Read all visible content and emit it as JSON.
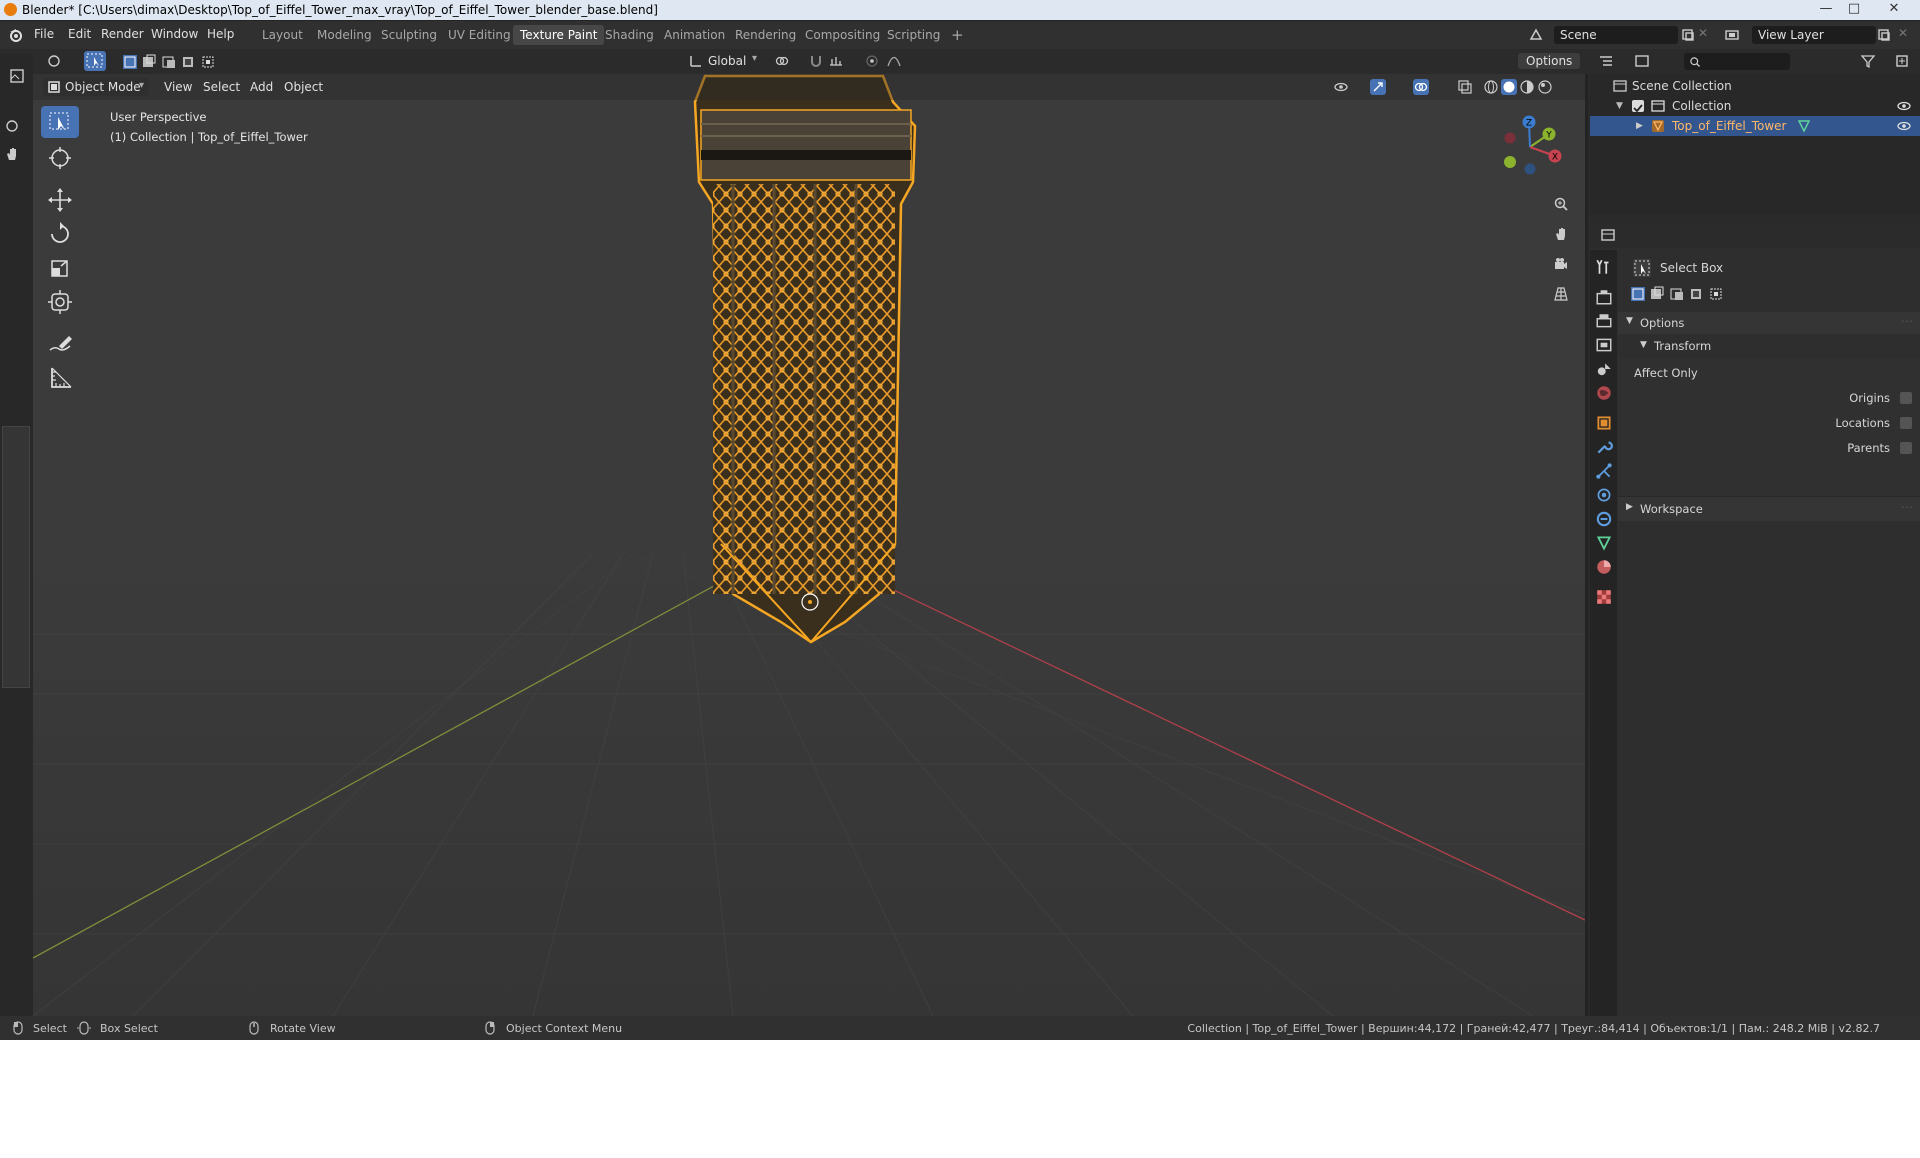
{
  "window": {
    "title": "Blender* [C:\\Users\\dimax\\Desktop\\Top_of_Eiffel_Tower_max_vray\\Top_of_Eiffel_Tower_blender_base.blend]"
  },
  "menus": [
    "File",
    "Edit",
    "Render",
    "Window",
    "Help"
  ],
  "workspaces": [
    "Layout",
    "Modeling",
    "Sculpting",
    "UV Editing",
    "Texture Paint",
    "Shading",
    "Animation",
    "Rendering",
    "Compositing",
    "Scripting"
  ],
  "active_workspace": "Texture Paint",
  "scene": {
    "name": "Scene",
    "view_layer": "View Layer"
  },
  "viewport": {
    "mode": "Object Mode",
    "menus": [
      "View",
      "Select",
      "Add",
      "Object"
    ],
    "orientation": "Global",
    "options_label": "Options",
    "overlay_title": "User Perspective",
    "overlay_subtitle": "(1) Collection | Top_of_Eiffel_Tower",
    "gizmo": {
      "x": "X",
      "y": "Y",
      "z": "Z"
    }
  },
  "outliner": {
    "root": "Scene Collection",
    "collection": "Collection",
    "object": "Top_of_Eiffel_Tower"
  },
  "properties": {
    "tool_name": "Select Box",
    "options_header": "Options",
    "transform_header": "Transform",
    "affect_only": "Affect Only",
    "checks": [
      {
        "label": "Origins",
        "checked": false
      },
      {
        "label": "Locations",
        "checked": false
      },
      {
        "label": "Parents",
        "checked": false
      }
    ],
    "workspace_header": "Workspace"
  },
  "status": {
    "select": "Select",
    "box_select": "Box Select",
    "rotate_view": "Rotate View",
    "context_menu": "Object Context Menu",
    "stats": "Collection | Top_of_Eiffel_Tower | Вершин:44,172 | Граней:42,477 | Треуг.:84,414 | Объектов:1/1 | Пам.: 248.2 MiB | v2.82.7"
  },
  "colors": {
    "accent": "#4772b3",
    "selection_outline": "#f5a623",
    "x_axis": "#c7434f",
    "y_axis": "#8cb32e",
    "z_axis": "#3b7ccf"
  }
}
